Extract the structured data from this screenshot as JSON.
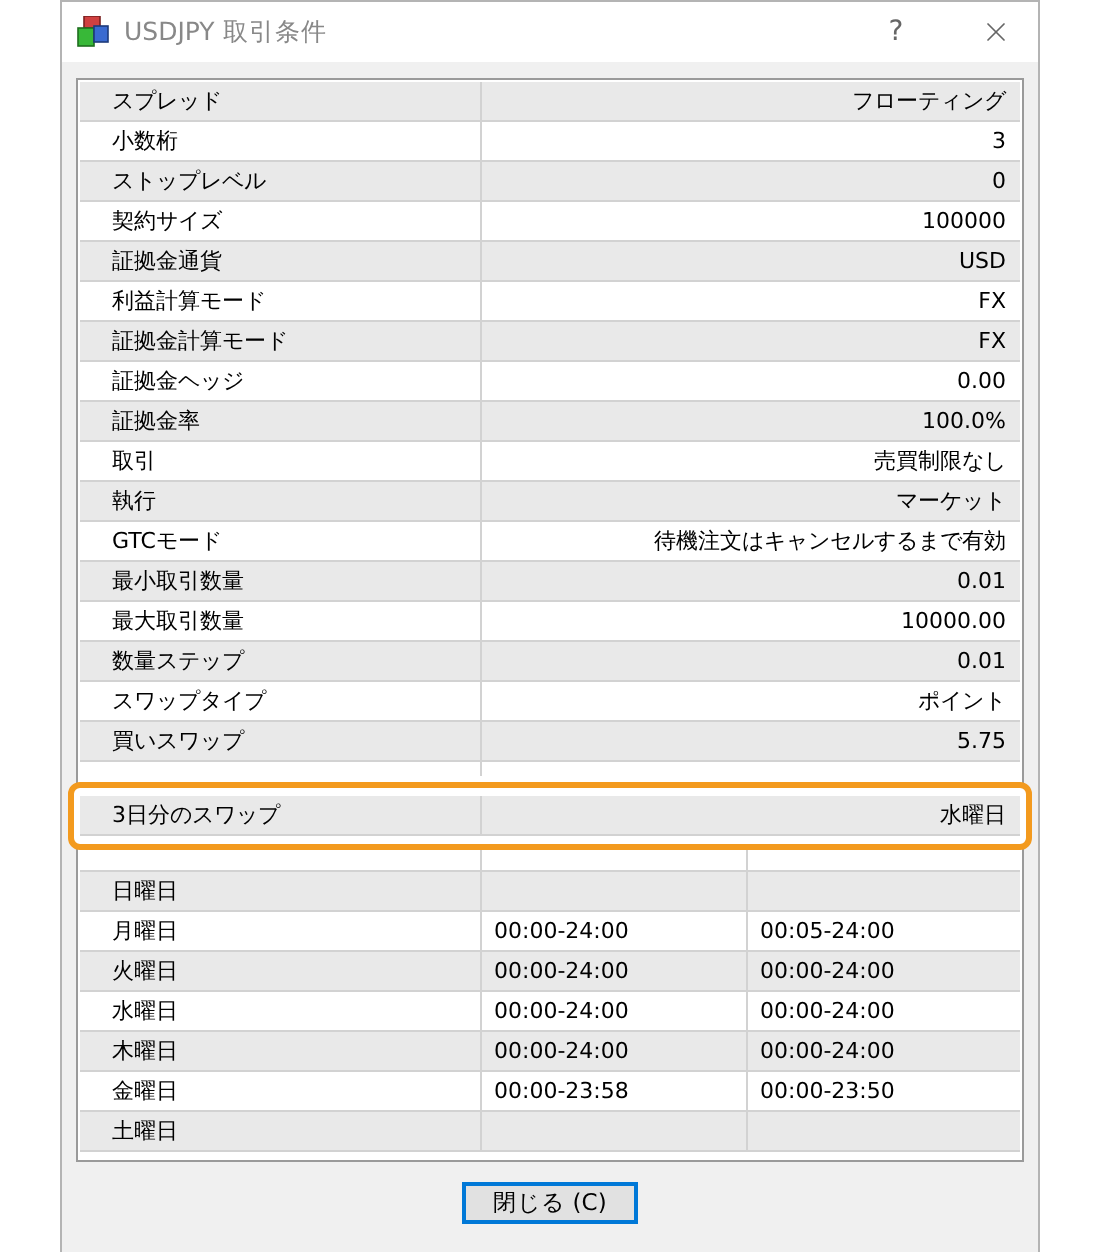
{
  "window": {
    "title": "USDJPY 取引条件",
    "help": "?"
  },
  "properties": [
    {
      "label": "スプレッド",
      "value": "フローティング"
    },
    {
      "label": "小数桁",
      "value": "3"
    },
    {
      "label": "ストップレベル",
      "value": "0"
    },
    {
      "label": "契約サイズ",
      "value": "100000"
    },
    {
      "label": "証拠金通貨",
      "value": "USD"
    },
    {
      "label": "利益計算モード",
      "value": "FX"
    },
    {
      "label": "証拠金計算モード",
      "value": "FX"
    },
    {
      "label": "証拠金ヘッジ",
      "value": "0.00"
    },
    {
      "label": "証拠金率",
      "value": "100.0%"
    },
    {
      "label": "取引",
      "value": "売買制限なし"
    },
    {
      "label": "執行",
      "value": "マーケット"
    },
    {
      "label": "GTCモード",
      "value": "待機注文はキャンセルするまで有効"
    },
    {
      "label": "最小取引数量",
      "value": "0.01"
    },
    {
      "label": "最大取引数量",
      "value": "10000.00"
    },
    {
      "label": "数量ステップ",
      "value": "0.01"
    },
    {
      "label": "スワップタイプ",
      "value": "ポイント"
    },
    {
      "label": "買いスワップ",
      "value": "5.75"
    }
  ],
  "highlight": {
    "label": "3日分のスワップ",
    "value": "水曜日"
  },
  "schedule": [
    {
      "day": "日曜日"
    },
    {
      "day": "月曜日",
      "quotes": "00:00-24:00",
      "trades": "00:05-24:00"
    },
    {
      "day": "火曜日",
      "quotes": "00:00-24:00",
      "trades": "00:00-24:00"
    },
    {
      "day": "水曜日",
      "quotes": "00:00-24:00",
      "trades": "00:00-24:00"
    },
    {
      "day": "木曜日",
      "quotes": "00:00-24:00",
      "trades": "00:00-24:00"
    },
    {
      "day": "金曜日",
      "quotes": "00:00-23:58",
      "trades": "00:00-23:50"
    },
    {
      "day": "土曜日"
    }
  ],
  "close_button": "閉じる (C)"
}
